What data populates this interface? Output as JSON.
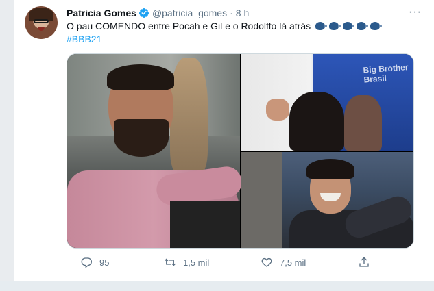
{
  "tweet": {
    "author": {
      "name": "Patricia Gomes",
      "handle": "@patricia_gomes",
      "verified": true
    },
    "separator": "·",
    "time": "8 h",
    "more_label": "···",
    "text_line1": "O pau COMENDO entre Pocah e Gil e o Rodolffo lá atrás",
    "text_line2": "#BBB21",
    "emoji": [
      "speaking-head-icon",
      "speaking-head-icon",
      "speaking-head-icon",
      "speaking-head-icon",
      "speaking-head-icon"
    ],
    "media": {
      "logo_text": "Big Brother Brasil"
    },
    "actions": {
      "reply_count": "95",
      "retweet_count": "1,5 mil",
      "like_count": "7,5 mil"
    }
  },
  "colors": {
    "accent": "#1da1f2",
    "muted": "#5b7083",
    "text": "#0f1419",
    "border": "#cfd9de"
  }
}
